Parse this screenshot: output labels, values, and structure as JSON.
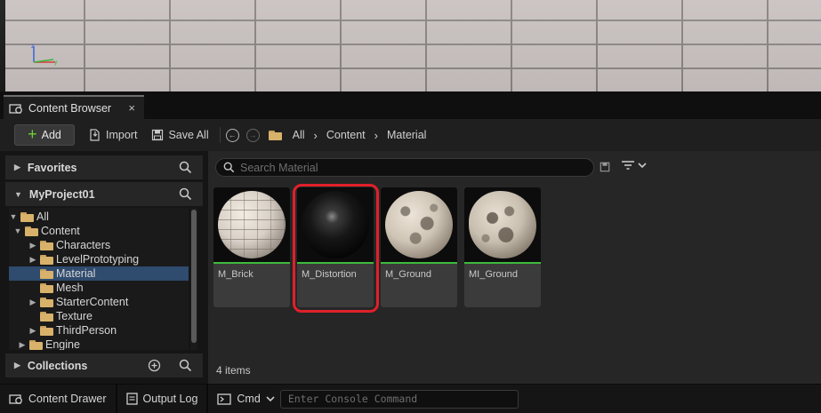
{
  "tab": {
    "title": "Content Browser",
    "close": "×"
  },
  "toolbar": {
    "add_label": "Add",
    "import_label": "Import",
    "save_all_label": "Save All",
    "breadcrumb": [
      "All",
      "Content",
      "Material"
    ]
  },
  "left_panel": {
    "favorites_label": "Favorites",
    "project_label": "MyProject01",
    "collections_label": "Collections",
    "tree": [
      {
        "label": "All"
      },
      {
        "label": "Content"
      },
      {
        "label": "Characters"
      },
      {
        "label": "LevelPrototyping"
      },
      {
        "label": "Material"
      },
      {
        "label": "Mesh"
      },
      {
        "label": "StarterContent"
      },
      {
        "label": "Texture"
      },
      {
        "label": "ThirdPerson"
      },
      {
        "label": "Engine"
      }
    ]
  },
  "search": {
    "placeholder": "Search Material"
  },
  "assets": [
    {
      "name": "M_Brick"
    },
    {
      "name": "M_Distortion"
    },
    {
      "name": "M_Ground"
    },
    {
      "name": "MI_Ground"
    }
  ],
  "item_count": "4 items",
  "bottom_bar": {
    "content_drawer": "Content Drawer",
    "output_log": "Output Log",
    "cmd": "Cmd",
    "console_placeholder": "Enter Console Command"
  },
  "colors": {
    "accent_green": "#3dbb3d",
    "selection_blue": "#2f4b6e",
    "highlight_red": "#e0202a"
  }
}
